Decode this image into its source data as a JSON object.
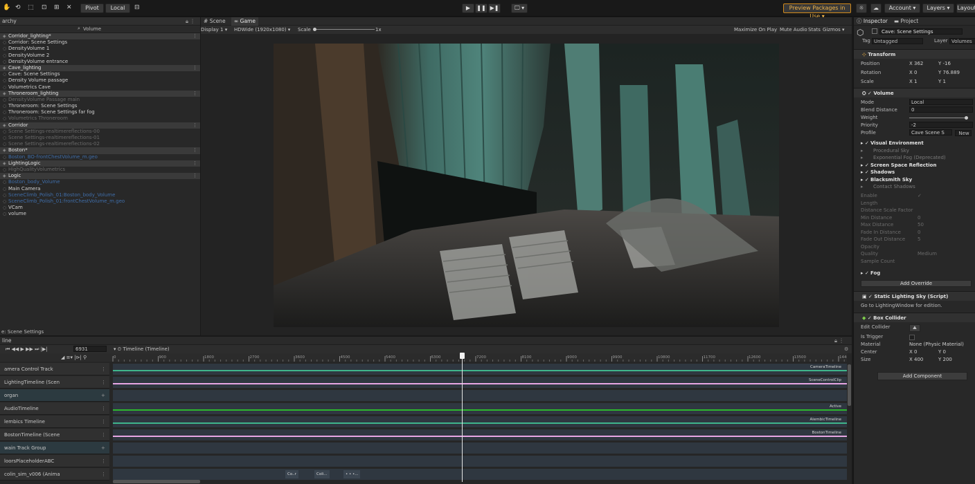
{
  "toolbar": {
    "pivot": "Pivot",
    "local": "Local",
    "play_glyph": "▶",
    "pause_glyph": "❚❚",
    "step_glyph": "▶❚",
    "display_select": "🖵 ▾",
    "preview_packages": "Preview Packages in Use ▾",
    "account": "Account ▾",
    "layers": "Layers ▾",
    "layout": "Layout"
  },
  "hierarchy": {
    "tab": "archy",
    "search": "Volume",
    "footer": "e: Scene Settings",
    "rows": [
      {
        "label": "Corridor_lighting*",
        "kind": "scene"
      },
      {
        "label": "Corridor: Scene Settings",
        "kind": "item"
      },
      {
        "label": "DensityVolume 1",
        "kind": "item"
      },
      {
        "label": "DensityVolume 2",
        "kind": "item"
      },
      {
        "label": "DensityVolume entrance",
        "kind": "item"
      },
      {
        "label": "Cave_lighting",
        "kind": "scene"
      },
      {
        "label": "Cave: Scene Settings",
        "kind": "item"
      },
      {
        "label": "Density Volume passage",
        "kind": "item"
      },
      {
        "label": "Volumetrics Cave",
        "kind": "item"
      },
      {
        "label": "Throneroom_lighting",
        "kind": "scene"
      },
      {
        "label": "DensityVolume Passage main",
        "kind": "dim"
      },
      {
        "label": "Throneroom: Scene Settings",
        "kind": "item"
      },
      {
        "label": "Throneroom: Scene Settings far fog",
        "kind": "item"
      },
      {
        "label": "Volumetrics Throneroom",
        "kind": "dim"
      },
      {
        "label": "Corridor",
        "kind": "scene"
      },
      {
        "label": "Scene Settings-realtimereflections-00",
        "kind": "dim"
      },
      {
        "label": "Scene Settings-realtimereflections-01",
        "kind": "dim"
      },
      {
        "label": "Scene Settings-realtimereflections-02",
        "kind": "dim"
      },
      {
        "label": "Boston*",
        "kind": "scene"
      },
      {
        "label": "Boston_BO-frontChestVolume_m.geo",
        "kind": "link"
      },
      {
        "label": "LightingLogic",
        "kind": "scene"
      },
      {
        "label": "HighQualityVolumetrics",
        "kind": "dim"
      },
      {
        "label": "Logic",
        "kind": "scene"
      },
      {
        "label": "Boston_body_Volume",
        "kind": "link"
      },
      {
        "label": "Main Camera",
        "kind": "item"
      },
      {
        "label": "SceneClimb_Polish_01:Boston_body_Volume",
        "kind": "link"
      },
      {
        "label": "SceneClimb_Polish_01:frontChestVolume_m.geo",
        "kind": "link"
      },
      {
        "label": "VCam",
        "kind": "item"
      },
      {
        "label": "volume",
        "kind": "item"
      }
    ]
  },
  "game": {
    "tab_scene": "Scene",
    "tab_game": "Game",
    "display": "Display 1 ▾",
    "resolution": "HDWide (1920x1080) ▾",
    "scale_label": "Scale",
    "scale_value": "1x",
    "maximize": "Maximize On Play",
    "mute": "Mute Audio",
    "stats": "Stats",
    "gizmos": "Gizmos ▾"
  },
  "inspector": {
    "tab_inspector": "Inspector",
    "tab_project": "Project",
    "object_name": "Cave: Scene Settings",
    "tag_label": "Tag",
    "tag_value": "Untagged",
    "layer_label": "Layer",
    "layer_value": "Volumes",
    "transform": "Transform",
    "position_label": "Position",
    "pos_x": "X 362",
    "pos_y": "Y -16",
    "rotation_label": "Rotation",
    "rot_x": "X 0",
    "rot_y": "Y 76.889",
    "scale_label": "Scale",
    "scl_x": "X 1",
    "scl_y": "Y 1",
    "volume": "Volume",
    "mode_label": "Mode",
    "mode_value": "Local",
    "blend_label": "Blend Distance",
    "blend_value": "0",
    "weight_label": "Weight",
    "priority_label": "Priority",
    "priority_value": "-2",
    "profile_label": "Profile",
    "profile_value": "Cave Scene S",
    "new_btn": "New",
    "overrides": [
      {
        "label": "Visual Environment",
        "bold": true
      },
      {
        "label": "Procedural Sky",
        "bold": false
      },
      {
        "label": "Exponential Fog (Deprecated)",
        "bold": false
      },
      {
        "label": "Screen Space Reflection",
        "bold": true
      },
      {
        "label": "Shadows",
        "bold": true
      },
      {
        "label": "Blacksmith Sky",
        "bold": true
      },
      {
        "label": "Contact Shadows",
        "bold": false
      }
    ],
    "contact_rows": [
      {
        "label": "Enable",
        "value": "✓"
      },
      {
        "label": "Length",
        "value": ""
      },
      {
        "label": "Distance Scale Factor",
        "value": ""
      },
      {
        "label": "Min Distance",
        "value": "0"
      },
      {
        "label": "Max Distance",
        "value": "50"
      },
      {
        "label": "Fade In Distance",
        "value": "0"
      },
      {
        "label": "Fade Out Distance",
        "value": "5"
      },
      {
        "label": "Opacity",
        "value": ""
      },
      {
        "label": "Quality",
        "value": "Medium"
      },
      {
        "label": "Sample Count",
        "value": ""
      }
    ],
    "fog": "Fog",
    "add_override": "Add Override",
    "static_sky": "Static Lighting Sky (Script)",
    "static_sky_note": "Go to LightingWindow for edition.",
    "box_collider": "Box Collider",
    "edit_collider": "Edit Collider",
    "is_trigger": "Is Trigger",
    "material_label": "Material",
    "material_value": "None (Physic Material)",
    "center_label": "Center",
    "center_x": "X 0",
    "center_y": "Y 0",
    "size_label": "Size",
    "size_x": "X 400",
    "size_y": "Y 200",
    "add_component": "Add Component"
  },
  "timeline": {
    "tab": "line",
    "frame": "6931",
    "asset": "Timeline (Timeline)",
    "ruler_ticks": [
      "0",
      "900",
      "1800",
      "2700",
      "3600",
      "4500",
      "5400",
      "6300",
      "7200",
      "8100",
      "9000",
      "9900",
      "10800",
      "11700",
      "12600",
      "13500",
      "14400"
    ],
    "tracks": [
      {
        "label": "amera Control Track",
        "clip": "CameraTimeline",
        "color": "#3fb58c"
      },
      {
        "label": "LightingTimeline (Scen",
        "clip": "SceneControlClip",
        "color": "#e8a6e4"
      },
      {
        "label": "organ",
        "clip": "",
        "color": ""
      },
      {
        "label": "AudioTimeline",
        "clip": "Active",
        "color": "#2db82d"
      },
      {
        "label": "lembics Timeline",
        "clip": "AlembicTimeline",
        "color": "#3fb58c"
      },
      {
        "label": "BostonTimeline (Scene",
        "clip": "BostonTimeline",
        "color": "#e8a6e4"
      },
      {
        "label": "wain Track Group",
        "clip": "",
        "color": ""
      },
      {
        "label": "loorsPlaceholderABC",
        "clip": "",
        "color": ""
      },
      {
        "label": "colin_sim_v006 (Anima",
        "clip": "",
        "color": ""
      }
    ],
    "bottom_clips": [
      "Co..r",
      "Coli...",
      "• • •..."
    ],
    "playhead_frame": 6931
  }
}
